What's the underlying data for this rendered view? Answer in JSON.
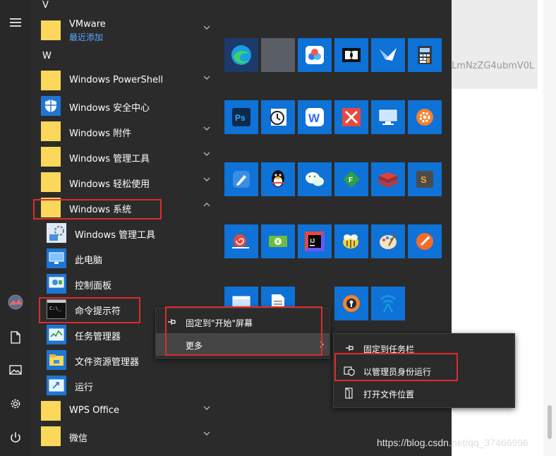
{
  "background": {
    "text": "LmNzZG4ubmV0L"
  },
  "letters": {
    "v": "V",
    "w": "W"
  },
  "apps": {
    "vmware": {
      "label": "VMware",
      "sub": "最近添加"
    },
    "powershell": "Windows PowerShell",
    "security": "Windows 安全中心",
    "accessories": "Windows 附件",
    "admin_tools": "Windows 管理工具",
    "ease": "Windows 轻松使用",
    "system": "Windows 系统",
    "sys_admin": "Windows 管理工具",
    "this_pc": "此电脑",
    "control_panel": "控制面板",
    "cmd": "命令提示符",
    "task_manager": "任务管理器",
    "explorer": "文件资源管理器",
    "run": "运行",
    "wps": "WPS Office",
    "wechat": "微信"
  },
  "context_menu": {
    "pin_start": "固定到\"开始\"屏幕",
    "more": "更多"
  },
  "submenu": {
    "pin_taskbar": "固定到任务栏",
    "run_admin": "以管理员身份运行",
    "open_location": "打开文件位置"
  },
  "watermark": "https://blog.csdn.net/qq_37466996",
  "colors": {
    "tile": "#0e72d6",
    "folder": "#fbd75b",
    "highlight": "#e02b2b",
    "accent_text": "#57a7ff"
  }
}
